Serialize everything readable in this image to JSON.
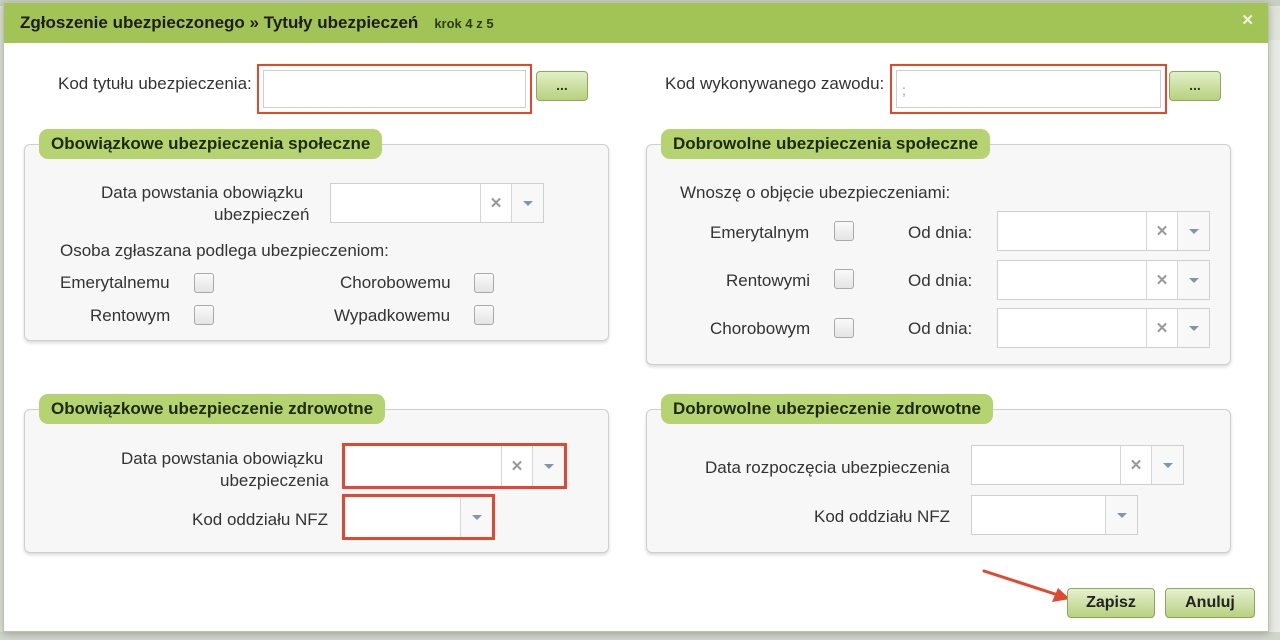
{
  "dialog": {
    "title": "Zgłoszenie ubezpieczonego » Tytuły ubezpieczeń",
    "step": "krok 4 z 5",
    "close_icon": "close-icon"
  },
  "top_fields": {
    "kod_tytulu_label": "Kod tytułu ubezpieczenia:",
    "kod_tytulu_value": "",
    "kod_zawodu_label": "Kod wykonywanego zawodu:",
    "kod_zawodu_value": ";",
    "browse_label": "..."
  },
  "obowiazkowe_spoleczne": {
    "legend": "Obowiązkowe ubezpieczenia społeczne",
    "date_label_line1": "Data powstania obowiązku",
    "date_label_line2": "ubezpieczeń",
    "subject_label": "Osoba zgłaszana podlega ubezpieczeniom:",
    "emerytalnemu": "Emerytalnemu",
    "chorobowemu": "Chorobowemu",
    "rentowym": "Rentowym",
    "wypadkowemu": "Wypadkowemu"
  },
  "dobrowolne_spoleczne": {
    "legend": "Dobrowolne ubezpieczenia społeczne",
    "intro": "Wnoszę o objęcie ubezpieczeniami:",
    "rows": [
      {
        "label": "Emerytalnym",
        "from_label": "Od dnia:"
      },
      {
        "label": "Rentowymi",
        "from_label": "Od dnia:"
      },
      {
        "label": "Chorobowym",
        "from_label": "Od dnia:"
      }
    ]
  },
  "obowiazkowe_zdrowotne": {
    "legend": "Obowiązkowe ubezpieczenie zdrowotne",
    "date_label_line1": "Data powstania obowiązku",
    "date_label_line2": "ubezpieczenia",
    "nfz_label": "Kod oddziału NFZ"
  },
  "dobrowolne_zdrowotne": {
    "legend": "Dobrowolne ubezpieczenie zdrowotne",
    "date_label": "Data rozpoczęcia ubezpieczenia",
    "nfz_label": "Kod oddziału NFZ"
  },
  "actions": {
    "save": "Zapisz",
    "cancel": "Anuluj"
  },
  "clear_glyph": "✕",
  "colors": {
    "titlebar": "#a2c456",
    "legend": "#b6d371",
    "highlight": "#e2472f"
  }
}
